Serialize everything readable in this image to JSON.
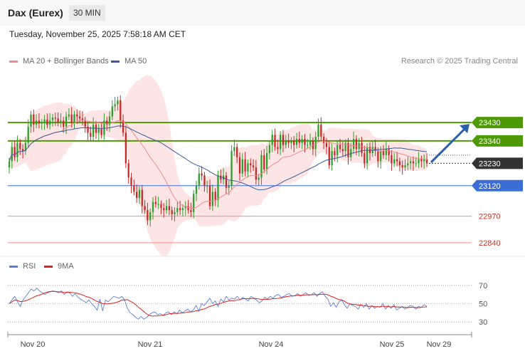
{
  "header": {
    "title": "Dax (Eurex)",
    "interval": "30 MIN",
    "timestamp": "Tuesday, November 25, 2025 7:58:18 AM CET"
  },
  "legend": {
    "ma20": "MA 20 + Bollinger Bands",
    "ma50": "MA 50",
    "credit": "Research © 2025 Trading Central",
    "rsi": "RSI",
    "rsi_ma": "9MA"
  },
  "colors": {
    "resistance": "#4e9a06",
    "support": "#3a6fd8",
    "support_far": "#ef8a8a",
    "current": "#333333",
    "candle_up": "#2e9e2e",
    "candle_down": "#c62828",
    "ma20": "#ef8a8a",
    "ma50": "#3a5a9c",
    "bollinger": "#fde0e0",
    "rsi": "#5b7fd6",
    "rsi_ma": "#e02020",
    "arrow": "#2d5ea8"
  },
  "chart_data": {
    "type": "candlestick",
    "price_range": [
      22780,
      23700
    ],
    "levels": [
      {
        "value": 23430,
        "label": "23430",
        "kind": "resistance"
      },
      {
        "value": 23340,
        "label": "23340",
        "kind": "resistance"
      },
      {
        "value": 23230,
        "label": "23230",
        "kind": "current"
      },
      {
        "value": 23120,
        "label": "23120",
        "kind": "support"
      },
      {
        "value": 22970,
        "label": "22970",
        "kind": "support_far"
      },
      {
        "value": 22840,
        "label": "22840",
        "kind": "support_far"
      }
    ],
    "x_ticks": [
      "Nov 20",
      "Nov 21",
      "Nov 24",
      "Nov 25",
      "Nov 29"
    ],
    "closes": [
      23240,
      23310,
      23260,
      23330,
      23300,
      23290,
      23330,
      23410,
      23470,
      23420,
      23440,
      23425,
      23430,
      23445,
      23420,
      23440,
      23455,
      23450,
      23430,
      23440,
      23410,
      23460,
      23470,
      23430,
      23470,
      23460,
      23450,
      23440,
      23410,
      23380,
      23360,
      23420,
      23380,
      23400,
      23370,
      23440,
      23420,
      23460,
      23510,
      23520,
      23540,
      23440,
      23380,
      23230,
      23160,
      23120,
      23090,
      23060,
      23100,
      23020,
      23000,
      22950,
      22990,
      23040,
      23030,
      23030,
      23010,
      23000,
      23020,
      23000,
      22980,
      22990,
      23010,
      23000,
      23010,
      23020,
      23000,
      22990,
      23080,
      23120,
      23180,
      23170,
      23120,
      23120,
      23020,
      23090,
      23050,
      23170,
      23150,
      23170,
      23110,
      23120,
      23290,
      23310,
      23260,
      23180,
      23250,
      23190,
      23230,
      23220,
      23210,
      23150,
      23160,
      23270,
      23200,
      23280,
      23320,
      23370,
      23310,
      23300,
      23370,
      23320,
      23340,
      23330,
      23340,
      23320,
      23350,
      23330,
      23350,
      23320,
      23320,
      23340,
      23300,
      23360,
      23420,
      23360,
      23330,
      23310,
      23220,
      23290,
      23270,
      23320,
      23300,
      23290,
      23330,
      23260,
      23300,
      23350,
      23300,
      23330,
      23280,
      23230,
      23310,
      23280,
      23310,
      23290,
      23240,
      23290,
      23270,
      23300,
      23270,
      23230,
      23250,
      23240,
      23220,
      23210,
      23220,
      23230,
      23240,
      23230,
      23230,
      23250,
      23240,
      23250,
      23230
    ],
    "rsi": {
      "range": [
        20,
        80
      ],
      "ticks": [
        70,
        50,
        30
      ],
      "values": [
        50,
        54,
        58,
        52,
        47,
        54,
        58,
        62,
        66,
        64,
        67,
        64,
        62,
        60,
        62,
        63,
        64,
        63,
        62,
        64,
        60,
        63,
        62,
        58,
        61,
        57,
        55,
        53,
        51,
        54,
        50,
        47,
        43,
        55,
        42,
        54,
        52,
        55,
        58,
        57,
        56,
        58,
        54,
        45,
        40,
        38,
        35,
        33,
        36,
        33,
        35,
        38,
        40,
        41,
        38,
        39,
        37,
        40,
        41,
        38,
        41,
        39,
        43,
        40,
        42,
        44,
        41,
        43,
        48,
        42,
        50,
        48,
        52,
        56,
        50,
        53,
        47,
        55,
        52,
        58,
        54,
        56,
        55,
        58,
        54,
        57,
        55,
        53,
        58,
        56,
        54,
        51,
        53,
        57,
        55,
        58,
        56,
        59,
        60,
        57,
        58,
        60,
        61,
        58,
        59,
        61,
        58,
        60,
        62,
        59,
        60,
        62,
        58,
        61,
        63,
        58,
        55,
        47,
        51,
        46,
        52,
        54,
        49,
        45,
        50,
        48,
        47,
        44,
        49,
        46,
        50,
        44,
        48,
        45,
        47,
        46,
        50,
        44,
        48,
        45,
        49,
        43,
        45,
        47,
        44,
        46,
        48,
        47,
        44,
        47,
        46,
        49,
        47
      ]
    }
  }
}
